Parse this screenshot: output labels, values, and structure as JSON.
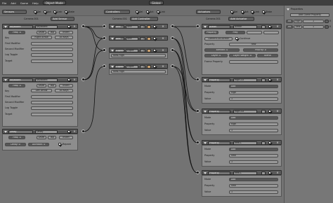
{
  "menu": {
    "items": [
      "File",
      "Add",
      "Game",
      "Help"
    ],
    "mode": "Object Mode",
    "global": "Global",
    "layout": "Logic",
    "scene": "Scene"
  },
  "columns": {
    "sensors": {
      "title": "Sensors",
      "obj": "Camera.001",
      "add": "Add Sensor",
      "sel": "Sel",
      "act": "Act",
      "link": "Link",
      "state": "State"
    },
    "controllers": {
      "title": "Controllers",
      "obj": "Camera.001",
      "add": "Add Controller",
      "sel": "Sel",
      "act": "Act",
      "link": "Link"
    },
    "actuators": {
      "title": "Actuators",
      "obj": "Camera.001",
      "add": "Add Actuator",
      "sel": "Sel",
      "act": "Act",
      "link": "Link",
      "state": "State"
    }
  },
  "sensors": [
    {
      "type": "Keyboard",
      "name": "Keyboard",
      "freq_label": "Freq:",
      "freq": "0",
      "level": "Level",
      "tap": "Tap",
      "invert": "Invert",
      "key_label": "Key",
      "key": "Right Arrow",
      "all_keys": "All Keys",
      "first_mod": "First Modifier",
      "second_mod": "Second Modifier",
      "log_toggle": "Log Toggle",
      "target": "Target"
    },
    {
      "type": "Keyboard",
      "name": "Keyboard",
      "freq_label": "Freq:",
      "freq": "0",
      "level": "Level",
      "tap": "Tap",
      "invert": "Invert",
      "key_label": "Key",
      "key": "Left Arrow",
      "all_keys": "All Keys",
      "first_mod": "First Modifier",
      "second_mod": "Second Modifier",
      "log_toggle": "Log Toggle",
      "target": "Target"
    },
    {
      "type": "Delay",
      "name": "Delay",
      "freq_label": "Freq:",
      "freq": "0",
      "level": "Level",
      "tap": "Tap",
      "invert": "Invert",
      "delay_label": "Delay:",
      "delay": "0",
      "duration_label": "Duration:",
      "duration": "0",
      "repeat": "Repeat"
    }
  ],
  "controllers": [
    {
      "type": "And",
      "name": "And",
      "num": "1"
    },
    {
      "type": "And",
      "name": "And",
      "num": "1"
    },
    {
      "type": "Expression",
      "name": "Expre",
      "num": "1",
      "expr": "Now-High"
    },
    {
      "type": "Expression",
      "name": "Expre",
      "num": "1",
      "expr": "Now-High"
    }
  ],
  "actuators": [
    {
      "type": "Action",
      "name": "Action",
      "sub": "Property",
      "mode": "Play",
      "action": "Camera.001Action",
      "continue": "Continue",
      "property_label": "Property",
      "property": "new",
      "blendin_label": "Blendin:",
      "blendin": "0",
      "priority_label": "Priority:",
      "priority": "0",
      "layer_label": "Layer:",
      "layer": "0",
      "lweight_label": "Layer Weight:",
      "lweight": "0",
      "blend": "Blend",
      "frame_prop": "Frame Property"
    },
    {
      "type": "Property",
      "name": "High-LD",
      "mode_label": "Mode",
      "mode": "Add",
      "property_label": "Property",
      "property": "high",
      "value_label": "Value",
      "value": "1"
    },
    {
      "type": "Property",
      "name": "High-LD",
      "mode_label": "Mode",
      "mode": "Add",
      "property_label": "Property",
      "property": "high",
      "value_label": "Value",
      "value": "1"
    },
    {
      "type": "Property",
      "name": "new-L",
      "mode_label": "Mode",
      "mode": "Add",
      "property_label": "Property",
      "property": "new",
      "value_label": "Value",
      "value": "1"
    },
    {
      "type": "Property",
      "name": "new-L",
      "mode_label": "Mode",
      "mode": "Add",
      "property_label": "Property",
      "property": "new",
      "value_label": "Value",
      "value": "1"
    }
  ],
  "properties": {
    "title": "Properties",
    "add": "Add Game Property",
    "items": [
      {
        "type": "Int",
        "name": "high",
        "value": "1"
      },
      {
        "type": "Int",
        "name": "new",
        "value": "1"
      }
    ]
  }
}
